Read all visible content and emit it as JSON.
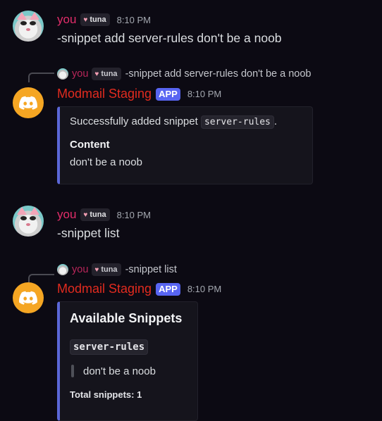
{
  "messages": [
    {
      "author": "you",
      "tag": "tuna",
      "time": "8:10 PM",
      "content": "-snippet add server-rules don't be a noob"
    },
    {
      "reply": {
        "author": "you",
        "tag": "tuna",
        "text": "-snippet add server-rules don't be a noob"
      },
      "author": "Modmail Staging",
      "badge": "APP",
      "time": "8:10 PM",
      "embed": {
        "prefix": "Successfully added snippet ",
        "code": "server-rules",
        "suffix": ".",
        "field_name": "Content",
        "field_value": "don't be a noob"
      }
    },
    {
      "author": "you",
      "tag": "tuna",
      "time": "8:10 PM",
      "content": "-snippet list"
    },
    {
      "reply": {
        "author": "you",
        "tag": "tuna",
        "text": "-snippet list"
      },
      "author": "Modmail Staging",
      "badge": "APP",
      "time": "8:10 PM",
      "embed": {
        "title": "Available Snippets",
        "snippet_name": "server-rules",
        "snippet_value": "don't be a noob",
        "footer": "Total snippets: 1"
      }
    }
  ],
  "colors": {
    "background": "#0c0a13",
    "user_name": "#e22d6a",
    "bot_name": "#e12b1f",
    "app_badge": "#5865f2",
    "embed_accent": "#5b67d8",
    "bot_avatar": "#f5a623"
  },
  "icons": {
    "bot_avatar": "discord-logo-icon",
    "tag_heart": "heart-icon"
  }
}
